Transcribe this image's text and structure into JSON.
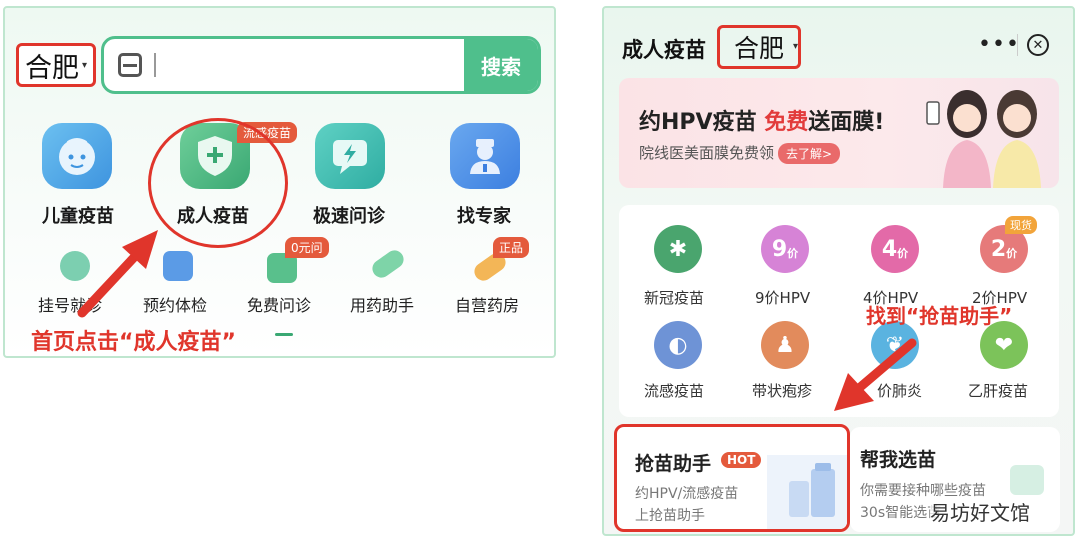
{
  "left": {
    "city": "合肥",
    "search_button": "搜索",
    "big_items": [
      {
        "label": "儿童疫苗",
        "icon": "baby-face-icon"
      },
      {
        "label": "成人疫苗",
        "icon": "shield-plus-icon",
        "tag": "流感疫苗"
      },
      {
        "label": "极速问诊",
        "icon": "lightning-chat-icon"
      },
      {
        "label": "找专家",
        "icon": "doctor-icon"
      }
    ],
    "small_items": [
      {
        "label": "挂号就诊",
        "icon": "clover-icon"
      },
      {
        "label": "预约体检",
        "icon": "clipboard-chart-icon"
      },
      {
        "label": "免费问诊",
        "icon": "phone-doctor-icon",
        "tag": "0元问"
      },
      {
        "label": "用药助手",
        "icon": "pill-icon"
      },
      {
        "label": "自营药房",
        "icon": "capsule-icon",
        "tag": "正品"
      }
    ],
    "caption": "首页点击“成人疫苗”"
  },
  "right": {
    "title": "成人疫苗",
    "city": "合肥",
    "more": "•••",
    "close": "✕",
    "banner": {
      "title_a": "约HPV疫苗 ",
      "title_hl": "免费",
      "title_b": "送面膜!",
      "sub": "院线医美面膜免费领",
      "button": "去了解>"
    },
    "vaccines": [
      {
        "label": "新冠疫苗",
        "icon": "virus-icon",
        "glyph": "✱",
        "color": "#4aa56e"
      },
      {
        "label": "9价HPV",
        "icon": "hpv-9-icon",
        "glyph": "9",
        "unit": "价",
        "color": "#d683d6"
      },
      {
        "label": "4价HPV",
        "icon": "hpv-4-icon",
        "glyph": "4",
        "unit": "价",
        "color": "#e36aa8"
      },
      {
        "label": "2价HPV",
        "icon": "hpv-2-icon",
        "glyph": "2",
        "unit": "价",
        "color": "#e67a7a",
        "tag": "现货"
      },
      {
        "label": "流感疫苗",
        "icon": "mask-face-icon",
        "glyph": "◐",
        "color": "#6e93d6"
      },
      {
        "label": "带状疱疹",
        "icon": "body-icon",
        "glyph": "♟",
        "color": "#e28b5c"
      },
      {
        "label": "价肺炎",
        "icon": "lungs-icon",
        "glyph": "❦",
        "color": "#5ab3e0"
      },
      {
        "label": "乙肝疫苗",
        "icon": "liver-icon",
        "glyph": "❤",
        "color": "#7cc35a"
      }
    ],
    "hot_card": {
      "title": "抢苗助手",
      "badge": "HOT",
      "line1": "约HPV/流感疫苗",
      "line2": "上抢苗助手"
    },
    "pick_card": {
      "title": "帮我选苗",
      "line1": "你需要接种哪些疫苗",
      "line2": "30s智能选苗"
    },
    "caption": "找到“抢苗助手”"
  },
  "watermark": "易坊好文馆"
}
